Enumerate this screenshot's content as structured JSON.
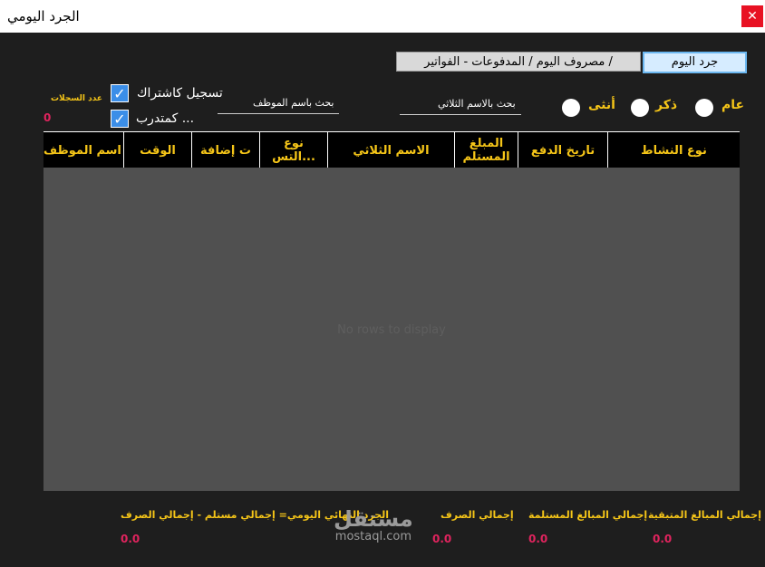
{
  "window": {
    "title": "الجرد اليومي",
    "close_glyph": "✕"
  },
  "tabs": [
    {
      "label": "جرد اليوم",
      "active": true
    },
    {
      "label": "مصروف اليوم / المدفوعات - الفواتير /",
      "active": false
    }
  ],
  "filters": {
    "radios": [
      {
        "label": "عام"
      },
      {
        "label": "ذكر"
      },
      {
        "label": "أنثى"
      }
    ],
    "search_full_name_label": "بحث بالاسم الثلاثي",
    "search_employee_label": "بحث باسم الموظف",
    "checkboxes": [
      {
        "label": "تسجيل كاشتراك",
        "checked": true
      },
      {
        "label": "كمتدرب ...",
        "checked": true
      }
    ],
    "record_count_label": "عدد السجلات",
    "record_count_value": "0"
  },
  "grid": {
    "columns": [
      "نوع النشاط",
      "تاريخ الدفع",
      "المبلغ المستلم",
      "الاسم الثلاثي",
      "نوع التس...",
      "ت إضافة",
      "الوقت",
      "اسم الموظف"
    ],
    "empty_text": "No rows to display"
  },
  "totals": [
    {
      "label": "إجمالي المبالغ المتبقية",
      "value": "0.0"
    },
    {
      "label": "إجمالي المبالغ المستلمة",
      "value": "0.0"
    },
    {
      "label": "إجمالي الصرف",
      "value": "0.0"
    },
    {
      "label": "الجرد النهائي اليومي= إجمالي مستلم - إجمالي الصرف",
      "value": "0.0"
    }
  ],
  "watermark": {
    "main": "مستقل",
    "sub": "mostaql.com"
  },
  "colors": {
    "background": "#1e1e1e",
    "accent_label": "#f5c518",
    "value_red": "#e0245e",
    "grid_body": "#505050"
  }
}
